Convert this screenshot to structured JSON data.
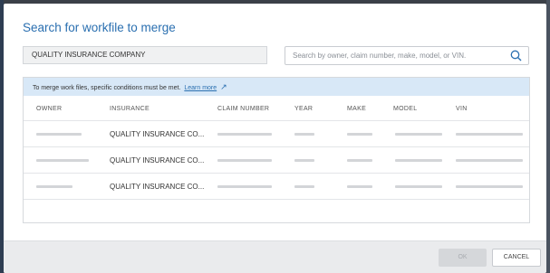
{
  "dialog": {
    "title": "Search for workfile to merge",
    "company_value": "QUALITY INSURANCE COMPANY",
    "search_placeholder": "Search by owner, claim number, make, model, or VIN.",
    "info_text": "To merge work files, specific conditions must be met.",
    "learn_more": "Learn more",
    "columns": [
      "OWNER",
      "INSURANCE",
      "CLAIM NUMBER",
      "YEAR",
      "MAKE",
      "MODEL",
      "VIN"
    ],
    "rows": [
      {
        "insurance": "QUALITY INSURANCE CO..."
      },
      {
        "insurance": "QUALITY INSURANCE CO..."
      },
      {
        "insurance": "QUALITY INSURANCE CO..."
      }
    ],
    "ok_label": "OK",
    "cancel_label": "CANCEL"
  },
  "icons": {
    "search": "search-icon",
    "external_link": "external-link-icon"
  },
  "colors": {
    "accent": "#2a6fb0",
    "info_bg": "#d8e8f7",
    "footer_bg": "#eaebed"
  }
}
